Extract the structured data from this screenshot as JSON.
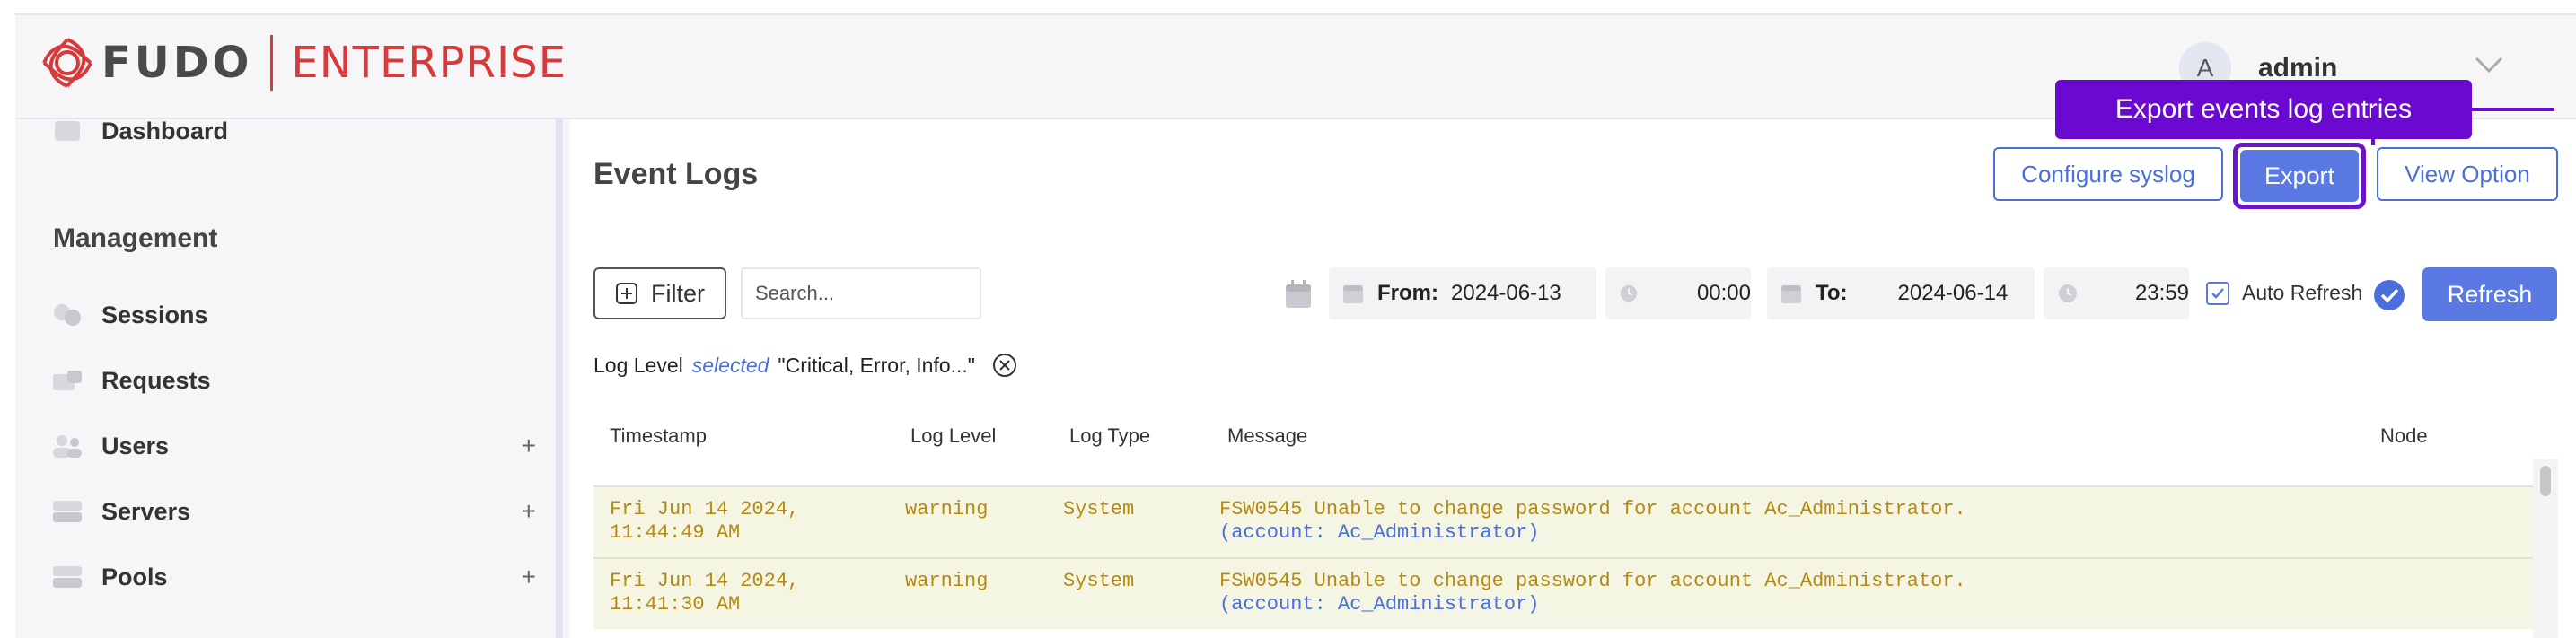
{
  "brand": {
    "name": "FUDO",
    "product": "ENTERPRISE"
  },
  "user": {
    "avatar_initial": "A",
    "name": "admin"
  },
  "sidebar": {
    "items": [
      {
        "label": "Dashboard"
      },
      {
        "label": "Sessions"
      },
      {
        "label": "Requests"
      },
      {
        "label": "Users",
        "expand": "+"
      },
      {
        "label": "Servers",
        "expand": "+"
      },
      {
        "label": "Pools",
        "expand": "+"
      }
    ],
    "section_heading": "Management"
  },
  "page": {
    "title": "Event Logs"
  },
  "toolbar": {
    "configure_syslog_label": "Configure syslog",
    "export_label": "Export",
    "view_option_label": "View Option",
    "refresh_label": "Refresh",
    "auto_refresh_label": "Auto Refresh",
    "auto_refresh_checked": true
  },
  "callout": {
    "text": "Export events log entries"
  },
  "filter": {
    "button_label": "Filter",
    "search_placeholder": "Search...",
    "from_label": "From:",
    "from_date": "2024-06-13",
    "from_time": "00:00",
    "to_label": "To:",
    "to_date": "2024-06-14",
    "to_time": "23:59"
  },
  "active_filter": {
    "field": "Log Level",
    "operator": "selected",
    "value": "\"Critical, Error, Info...\""
  },
  "table": {
    "columns": [
      "Timestamp",
      "Log Level",
      "Log Type",
      "Message",
      "Node"
    ],
    "rows": [
      {
        "timestamp_line1": "Fri Jun 14 2024,",
        "timestamp_line2": "11:44:49 AM",
        "level": "warning",
        "type": "System",
        "message": "FSW0545 Unable to change password for account Ac_Administrator.",
        "context": "(account: Ac_Administrator)"
      },
      {
        "timestamp_line1": "Fri Jun 14 2024,",
        "timestamp_line2": "11:41:30 AM",
        "level": "warning",
        "type": "System",
        "message": "FSW0545 Unable to change password for account Ac_Administrator.",
        "context": "(account: Ac_Administrator)"
      }
    ]
  },
  "colors": {
    "brand_red": "#d63b3b",
    "accent_blue": "#5b79e2",
    "callout_purple": "#6a0ad0",
    "warning_text": "#b58a12",
    "warning_row_bg": "#f4f5e2"
  }
}
